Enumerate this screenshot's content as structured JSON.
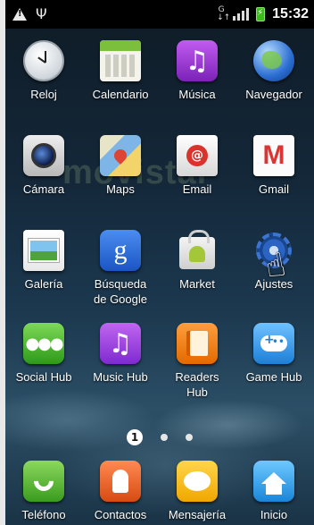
{
  "status_bar": {
    "time": "15:32",
    "network_type": "G",
    "icons": [
      "warning-icon",
      "usb-icon",
      "network-type-icon",
      "signal-icon",
      "battery-charging-icon"
    ]
  },
  "watermark_text": "movistar",
  "apps": [
    {
      "label": "Reloj",
      "icon": "clock-icon"
    },
    {
      "label": "Calendario",
      "icon": "calendar-icon"
    },
    {
      "label": "Música",
      "icon": "music-icon"
    },
    {
      "label": "Navegador",
      "icon": "browser-globe-icon"
    },
    {
      "label": "Cámara",
      "icon": "camera-icon"
    },
    {
      "label": "Maps",
      "icon": "maps-icon"
    },
    {
      "label": "Email",
      "icon": "email-icon"
    },
    {
      "label": "Gmail",
      "icon": "gmail-icon"
    },
    {
      "label": "Galería",
      "icon": "gallery-icon"
    },
    {
      "label": "Búsqueda\nde Google",
      "icon": "google-search-icon"
    },
    {
      "label": "Market",
      "icon": "market-icon"
    },
    {
      "label": "Ajustes",
      "icon": "settings-gear-icon"
    },
    {
      "label": "Social Hub",
      "icon": "social-hub-icon"
    },
    {
      "label": "Music Hub",
      "icon": "music-hub-icon"
    },
    {
      "label": "Readers\nHub",
      "icon": "readers-hub-icon"
    },
    {
      "label": "Game Hub",
      "icon": "game-hub-icon"
    }
  ],
  "page_indicator": {
    "current": "1",
    "total_pages": 3
  },
  "dock": [
    {
      "label": "Teléfono",
      "icon": "phone-icon"
    },
    {
      "label": "Contactos",
      "icon": "contacts-icon"
    },
    {
      "label": "Mensajería",
      "icon": "messaging-icon"
    },
    {
      "label": "Inicio",
      "icon": "home-icon"
    }
  ]
}
